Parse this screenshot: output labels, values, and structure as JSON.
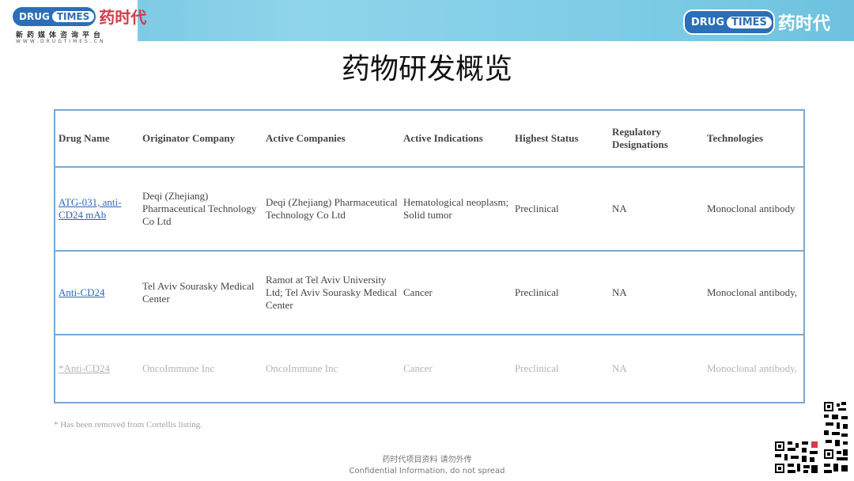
{
  "header": {
    "logo_drug": "DRUG",
    "logo_times": "TIMES",
    "logo_cn": "药时代",
    "logo_tagline": "新药媒体咨询平台",
    "logo_url": "WWW.DRUGTIMES.CN"
  },
  "page_title": "药物研发概览",
  "table": {
    "columns": [
      "Drug Name",
      "Originator Company",
      "Active Companies",
      "Active Indications",
      "Highest Status",
      "Regulatory Designations",
      "Technologies"
    ],
    "rows": [
      {
        "drug": "ATG-031, anti-CD24 mAb",
        "originator": "Deqi (Zhejiang) Pharmaceutical Technology Co Ltd",
        "active": "Deqi (Zhejiang) Pharmaceutical Technology Co Ltd",
        "indications": "Hematological neoplasm; Solid tumor",
        "status": "Preclinical",
        "designations": "NA",
        "technologies": "Monoclonal antibody"
      },
      {
        "drug": "Anti-CD24",
        "originator": "Tel Aviv Sourasky Medical Center",
        "active": "Ramot at Tel Aviv University Ltd; Tel Aviv Sourasky Medical Center",
        "indications": "Cancer",
        "status": "Preclinical",
        "designations": "NA",
        "technologies": "Monoclonal antibody,"
      },
      {
        "drug": "*Anti-CD24",
        "originator": "OncoImmune Inc",
        "active": "OncoImmune Inc",
        "indications": "Cancer",
        "status": "Preclinical",
        "designations": "NA",
        "technologies": "Monoclonal antibody,"
      }
    ]
  },
  "footnote": "* Has been removed from Cortellis listing.",
  "confidential": {
    "cn": "药时代项目资料 请勿外传",
    "en": "Confidential Information, do not spread"
  }
}
